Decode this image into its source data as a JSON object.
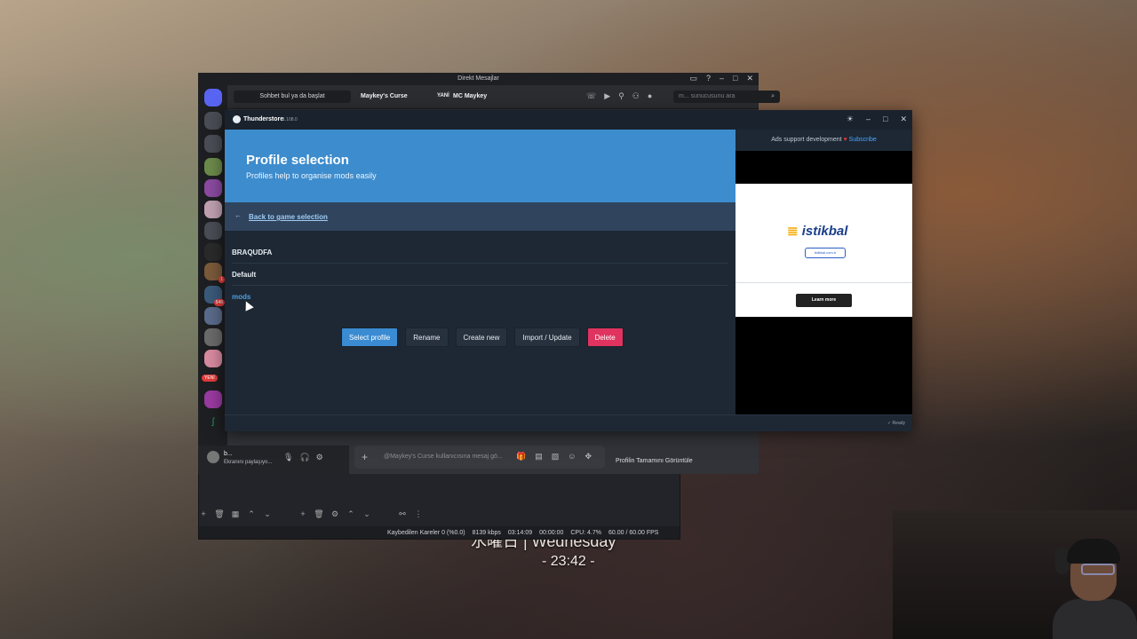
{
  "wallpaper": {
    "date_text": "水曜日 | Wednesday",
    "time_text": "- 23:42 -"
  },
  "obs": {
    "stats": [
      "Kaybedilen Kareler 0 (%0.0)",
      "8139 kbps",
      "03:14:09",
      "00:00:00",
      "CPU: 4.7%",
      "60.00 / 60.00 FPS"
    ]
  },
  "discord": {
    "window_title": "Direkt Mesajlar",
    "search_conversation": "Sohbet bul ya da başlat",
    "channel_name": "Maykey's Curse",
    "tag": "YANİ",
    "user_name": "MC Maykey",
    "search_placeholder": "m... sunucusunu ara",
    "message_placeholder": "@Maykey's Curse kullanıcısına mesaj gö...",
    "profile_button": "Profilin Tamamını Görüntüle",
    "user_panel": {
      "name": "b...",
      "status": "Ekranını paylaşıyo..."
    },
    "badges": [
      "1",
      "546",
      "YENİ"
    ]
  },
  "thunderstore": {
    "app_name": "Thunderstore",
    "version": "1.108.0",
    "hero_title": "Profile selection",
    "hero_subtitle": "Profiles help to organise mods easily",
    "back_label": "Back to game selection",
    "profiles": [
      "BRAQUDFA",
      "Default",
      "mods"
    ],
    "buttons": {
      "select": "Select profile",
      "rename": "Rename",
      "create": "Create new",
      "import": "Import / Update",
      "delete": "Delete"
    },
    "status": "Ready",
    "ad": {
      "support_text": "Ads support development",
      "subscribe": "Subscribe",
      "brand": "istikbal",
      "learn_more": "Learn more"
    }
  },
  "colors": {
    "accent_blue": "#3d8ccd",
    "delete_red": "#e0335f"
  }
}
